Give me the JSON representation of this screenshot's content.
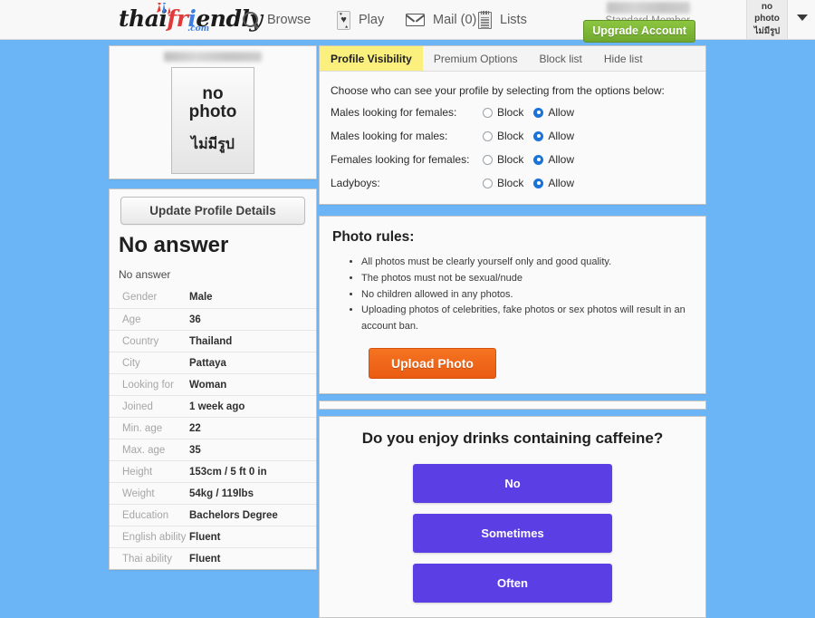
{
  "header": {
    "logo": {
      "part1": "thai",
      "part2": "fr",
      "part3": "i",
      "part4": "endly",
      "tld": ".com"
    },
    "nav": [
      {
        "label": "Browse",
        "icon": "search-icon"
      },
      {
        "label": "Play",
        "icon": "playing-card-heart-icon"
      },
      {
        "label": "Mail (0)",
        "icon": "envelope-icon"
      },
      {
        "label": "Lists",
        "icon": "notepad-icon"
      }
    ],
    "account": {
      "username_redacted": "",
      "status": "Standard Member",
      "upgrade_label": "Upgrade Account",
      "thumb_line1": "no",
      "thumb_line2": "photo",
      "thumb_thai": "ไม่มีรูป"
    }
  },
  "sidebar": {
    "photo": {
      "name_redacted": "",
      "no_photo_line1": "no",
      "no_photo_line2": "photo",
      "no_photo_thai": "ไม่มีรูป"
    },
    "update_button": "Update Profile Details",
    "title": "No answer",
    "subtitle": "No answer",
    "details": [
      {
        "key": "Gender",
        "value": "Male"
      },
      {
        "key": "Age",
        "value": "36"
      },
      {
        "key": "Country",
        "value": "Thailand"
      },
      {
        "key": "City",
        "value": "Pattaya"
      },
      {
        "key": "Looking for",
        "value": "Woman"
      },
      {
        "key": "Joined",
        "value": "1 week ago"
      },
      {
        "key": "Min. age",
        "value": "22"
      },
      {
        "key": "Max. age",
        "value": "35"
      },
      {
        "key": "Height",
        "value": "153cm / 5 ft 0 in"
      },
      {
        "key": "Weight",
        "value": "54kg / 119lbs"
      },
      {
        "key": "Education",
        "value": "Bachelors Degree"
      },
      {
        "key": "English ability",
        "value": "Fluent"
      },
      {
        "key": "Thai ability",
        "value": "Fluent"
      }
    ]
  },
  "main": {
    "tabs": [
      {
        "label": "Profile Visibility",
        "active": true
      },
      {
        "label": "Premium Options",
        "active": false
      },
      {
        "label": "Block list",
        "active": false
      },
      {
        "label": "Hide list",
        "active": false
      }
    ],
    "visibility": {
      "intro": "Choose who can see your profile by selecting from the options below:",
      "block_label": "Block",
      "allow_label": "Allow",
      "rows": [
        {
          "label": "Males looking for females:",
          "selected": "Allow"
        },
        {
          "label": "Males looking for males:",
          "selected": "Allow"
        },
        {
          "label": "Females looking for females:",
          "selected": "Allow"
        },
        {
          "label": "Ladyboys:",
          "selected": "Allow"
        }
      ]
    },
    "photo_rules": {
      "title": "Photo rules:",
      "items": [
        "All photos must be clearly yourself only and good quality.",
        "The photos must not be sexual/nude",
        "No children allowed in any photos.",
        "Uploading photos of celebrities, fake photos or sex photos will result in an account ban."
      ],
      "upload_label": "Upload Photo"
    },
    "poll": {
      "question": "Do you enjoy drinks containing caffeine?",
      "options": [
        "No",
        "Sometimes",
        "Often"
      ]
    }
  },
  "colors": {
    "page_background": "#6bb5f7",
    "tab_active": "#fbef7d",
    "poll_button": "#5b3fe4",
    "upload_button": "#ea5b12",
    "upgrade_button": "#8cc63f",
    "radio_selected": "#1a73d8"
  }
}
